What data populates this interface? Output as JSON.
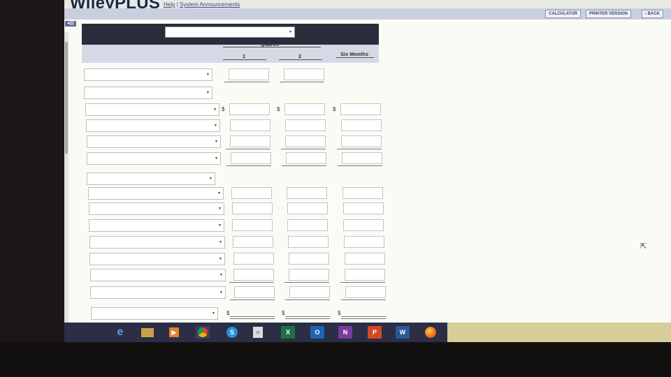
{
  "header": {
    "logo": "WileyPLUS",
    "help_link": "Help",
    "separator": "|",
    "announcements_link": "System Announcements"
  },
  "toolbar": {
    "calculator_label": "CALCULATOR",
    "printer_label": "PRINTER VERSION",
    "back_label": "‹ BACK"
  },
  "form": {
    "quarter_label": "Quarter",
    "col_q1": "1",
    "col_q2": "2",
    "col_six_months": "Six Months",
    "currency_symbol": "$"
  },
  "colors": {
    "header_bar": "#2b2d3c",
    "subheader_bar": "#d5d9e6",
    "toolbar": "#c9cfdd",
    "taskbar": "#2b2e45"
  },
  "taskbar_icons": [
    "internet-explorer-icon",
    "file-explorer-icon",
    "media-player-icon",
    "chrome-icon",
    "skype-icon",
    "notepad-icon",
    "excel-icon",
    "outlook-icon",
    "onenote-icon",
    "powerpoint-icon",
    "word-icon",
    "firefox-icon"
  ]
}
